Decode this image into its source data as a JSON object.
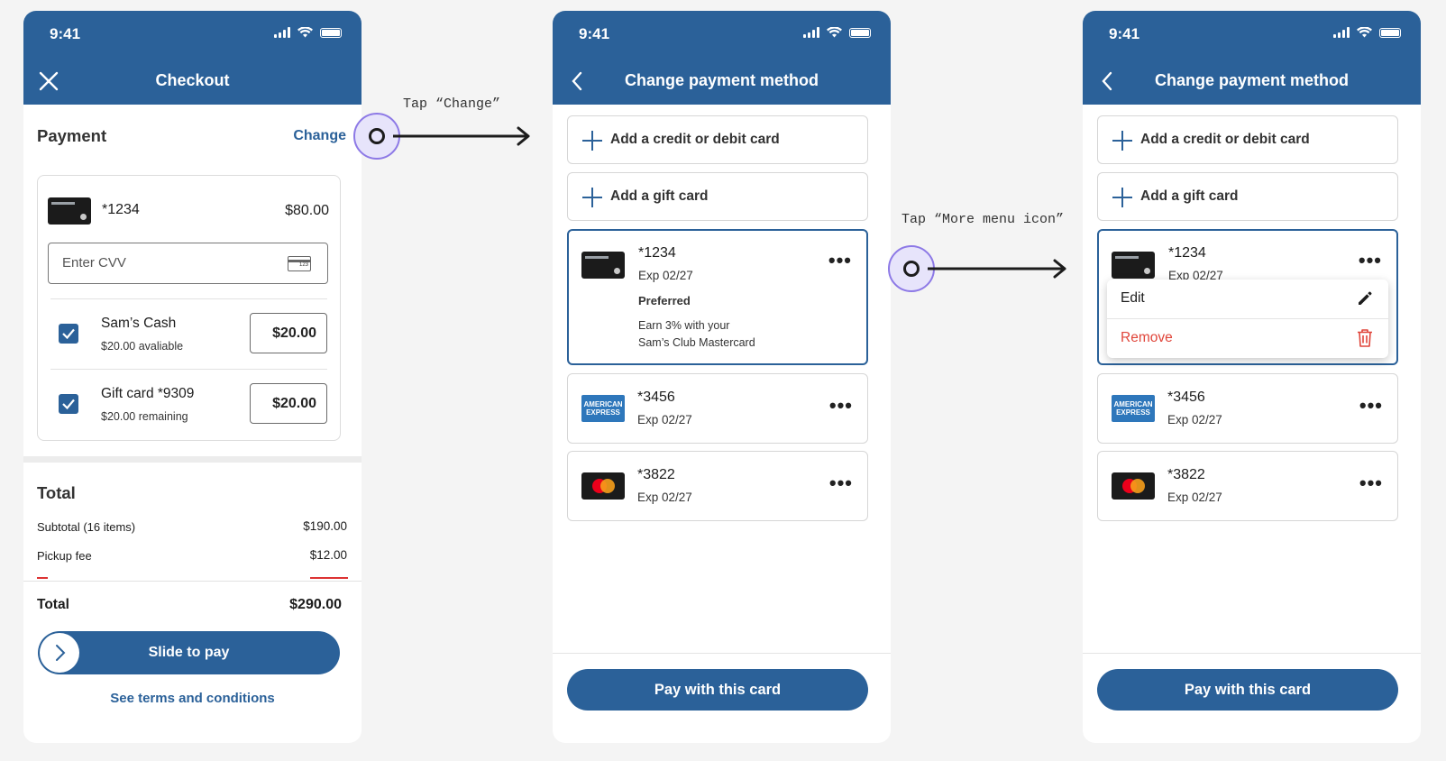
{
  "annotations": {
    "step1": "Tap “Change”",
    "step2": "Tap “More menu icon”"
  },
  "status_time": "9:41",
  "checkout": {
    "title": "Checkout",
    "payment_title": "Payment",
    "change_label": "Change",
    "card_number": "*1234",
    "card_amount": "$80.00",
    "cvv_placeholder": "Enter CVV",
    "cvv_icon_text": "123",
    "sams_cash": {
      "label": "Sam’s Cash",
      "sub": "$20.00 avaliable",
      "amount": "$20.00"
    },
    "gift_card": {
      "label": "Gift card *9309",
      "sub": "$20.00 remaining",
      "amount": "$20.00"
    },
    "total_title": "Total",
    "lines": [
      {
        "label": "Subtotal (16 items)",
        "value": "$190.00"
      },
      {
        "label": "Pickup fee",
        "value": "$12.00"
      }
    ],
    "total_label": "Total",
    "total_value": "$290.00",
    "slide_label": "Slide to pay",
    "terms_label": "See terms and conditions"
  },
  "change_payment": {
    "title": "Change payment method",
    "add_card": "Add a credit or debit card",
    "add_gift": "Add a gift card",
    "card1": {
      "number": "*1234",
      "exp": "Exp 02/27",
      "preferred": "Preferred",
      "promo1": "Earn 3% with your",
      "promo2": "Sam’s Club Mastercard"
    },
    "card2": {
      "number": "*3456",
      "exp": "Exp 02/27",
      "brand": "AMERICAN EXPRESS"
    },
    "card3": {
      "number": "*3822",
      "exp": "Exp 02/27"
    },
    "pay_button": "Pay with this card"
  },
  "menu": {
    "edit": "Edit",
    "remove": "Remove"
  },
  "colors": {
    "primary": "#2b6199",
    "remove": "#e0453a",
    "tap_ring": "#8d79e6"
  }
}
